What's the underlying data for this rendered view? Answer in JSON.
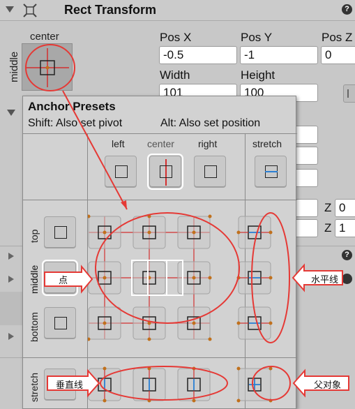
{
  "component": {
    "title": "Rect Transform",
    "help_glyph": "?"
  },
  "anchor": {
    "h_label": "center",
    "v_label": "middle"
  },
  "fields": {
    "pos_x_label": "Pos X",
    "pos_y_label": "Pos Y",
    "pos_z_label": "Pos Z",
    "pos_x": "-0.5",
    "pos_y": "-1",
    "pos_z": "0",
    "width_label": "Width",
    "height_label": "Height",
    "width": "101",
    "height": "100",
    "rot_z_label": "Z",
    "rot_z": "0",
    "scale_z_label": "Z",
    "scale_z": "1"
  },
  "popup": {
    "title": "Anchor Presets",
    "hint_shift": "Shift: Also set pivot",
    "hint_alt": "Alt: Also set position",
    "col_left": "left",
    "col_center": "center",
    "col_right": "right",
    "col_stretch": "stretch",
    "row_top": "top",
    "row_middle": "middle",
    "row_bottom": "bottom",
    "row_stretch": "stretch"
  },
  "annotations": {
    "point": "点",
    "horizontal": "水平线",
    "vertical": "垂直线",
    "parent": "父对象"
  },
  "colors": {
    "anchor_red": "#d32f2f",
    "pivot_orange": "#c0701c",
    "stretch_blue": "#2a7fd4",
    "annotation_red": "#e53935"
  }
}
